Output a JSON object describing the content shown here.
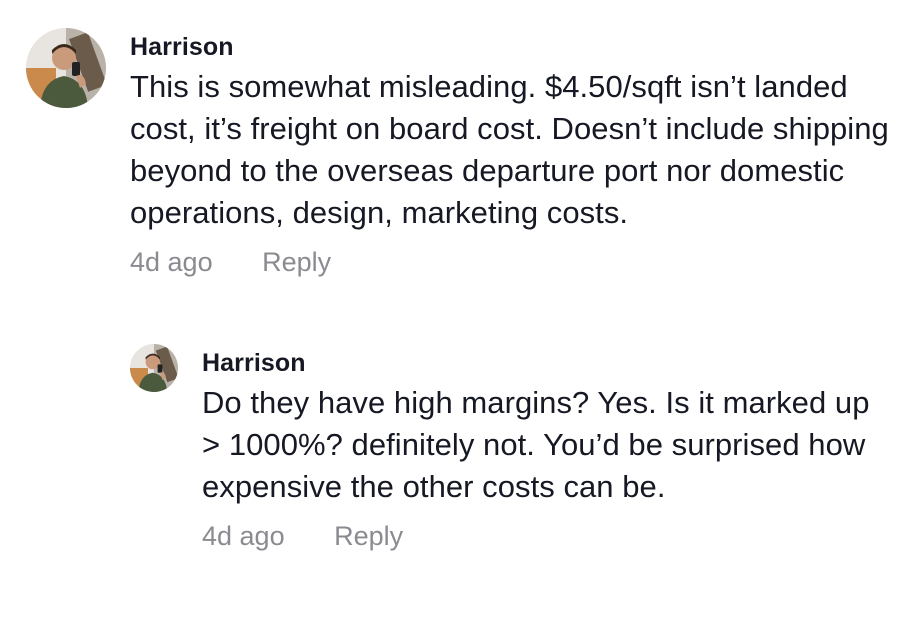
{
  "comments": [
    {
      "username": "Harrison",
      "text": "This is somewhat misleading. $4.50/sqft isn’t landed cost, it’s freight on board cost. Doesn’t include shipping beyond to the overseas departure port nor domestic operations, design, marketing costs.",
      "time": "4d ago",
      "reply_label": "Reply",
      "avatar_icon": "user-avatar-photo"
    }
  ],
  "replies": [
    {
      "username": "Harrison",
      "text": "Do they have high margins? Yes. Is it marked up > 1000%? definitely not. You’d be surprised how expensive the other costs can be.",
      "time": "4d ago",
      "reply_label": "Reply",
      "avatar_icon": "user-avatar-photo"
    }
  ],
  "colors": {
    "text": "#161823",
    "meta": "#8a8b91"
  }
}
